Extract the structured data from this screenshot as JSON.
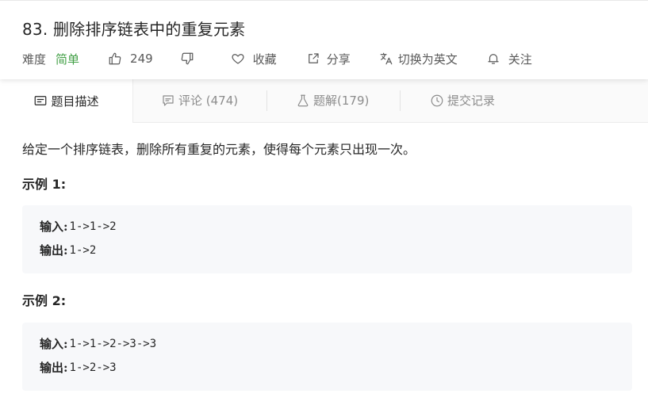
{
  "problem": {
    "title": "83. 删除排序链表中的重复元素",
    "difficulty_label": "难度",
    "difficulty_value": "简单",
    "likes": "249",
    "actions": {
      "favorite": "收藏",
      "share": "分享",
      "switch_lang": "切换为英文",
      "follow": "关注"
    }
  },
  "colors": {
    "difficulty_easy": "#43a047",
    "text": "#262626",
    "muted": "#8c8c8c",
    "example_bg": "#f7f8fa"
  },
  "tabs": [
    {
      "label": "题目描述",
      "icon": "description-icon",
      "active": true
    },
    {
      "label": "评论 (474)",
      "icon": "comment-icon",
      "active": false
    },
    {
      "label": "题解(179)",
      "icon": "flask-icon",
      "active": false
    },
    {
      "label": "提交记录",
      "icon": "clock-icon",
      "active": false
    }
  ],
  "content": {
    "description": "给定一个排序链表，删除所有重复的元素，使得每个元素只出现一次。",
    "examples": [
      {
        "title": "示例 1:",
        "input_label": "输入:",
        "input": "1->1->2",
        "output_label": "输出:",
        "output": "1->2"
      },
      {
        "title": "示例 2:",
        "input_label": "输入:",
        "input": "1->1->2->3->3",
        "output_label": "输出:",
        "output": "1->2->3"
      }
    ]
  }
}
